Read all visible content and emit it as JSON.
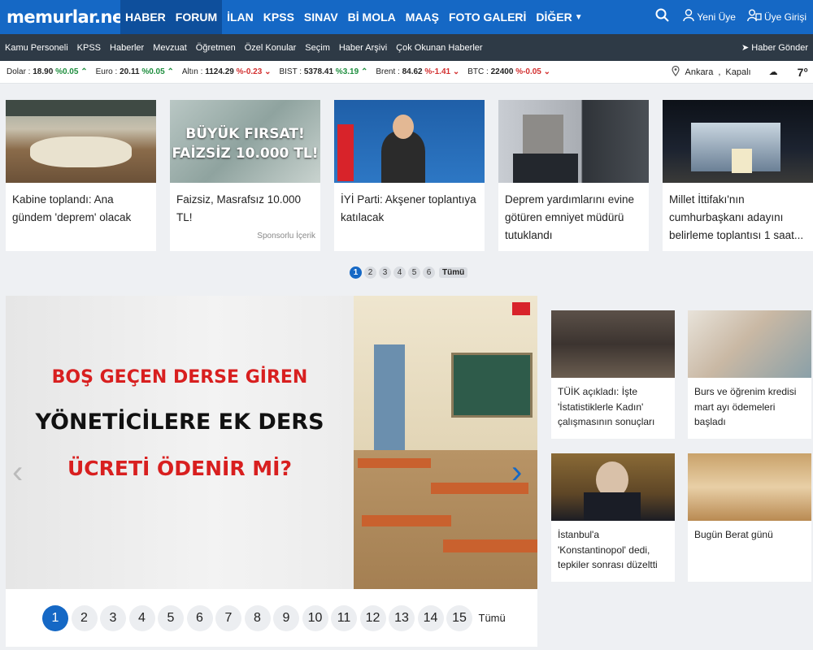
{
  "logo": "memurlar.net",
  "nav": [
    {
      "label": "HABER",
      "active": true
    },
    {
      "label": "FORUM",
      "active": true
    },
    {
      "label": "İLAN"
    },
    {
      "label": "KPSS"
    },
    {
      "label": "SINAV"
    },
    {
      "label": "Bİ MOLA"
    },
    {
      "label": "MAAŞ"
    },
    {
      "label": "FOTO GALERİ"
    },
    {
      "label": "DİĞER"
    }
  ],
  "top_right": {
    "new_member": "Yeni Üye",
    "login": "Üye Girişi"
  },
  "subnav": [
    "Kamu Personeli",
    "KPSS",
    "Haberler",
    "Mevzuat",
    "Öğretmen",
    "Özel Konular",
    "Seçim",
    "Haber Arşivi",
    "Çok Okunan Haberler"
  ],
  "send_news": "Haber Gönder",
  "ticker": [
    {
      "name": "Dolar",
      "value": "18.90",
      "change": "%0.05",
      "dir": "up"
    },
    {
      "name": "Euro",
      "value": "20.11",
      "change": "%0.05",
      "dir": "up"
    },
    {
      "name": "Altın",
      "value": "1124.29",
      "change": "%-0.23",
      "dir": "down"
    },
    {
      "name": "BIST",
      "value": "5378.41",
      "change": "%3.19",
      "dir": "up"
    },
    {
      "name": "Brent",
      "value": "84.62",
      "change": "%-1.41",
      "dir": "down"
    },
    {
      "name": "BTC",
      "value": "22400",
      "change": "%-0.05",
      "dir": "down"
    }
  ],
  "weather": {
    "city": "Ankara",
    "condition": "Kapalı",
    "temp": "7°"
  },
  "cards": [
    {
      "title": "Kabine toplandı: Ana gündem 'deprem' olacak"
    },
    {
      "title": "Faizsiz, Masrafsız 10.000 TL!",
      "sponsored": "Sponsorlu İçerik",
      "img_line1": "BÜYÜK FIRSAT!",
      "img_line2": "FAİZSİZ 10.000 TL!"
    },
    {
      "title": "İYİ Parti: Akşener toplantıya katılacak"
    },
    {
      "title": "Deprem yardımlarını evine götüren emniyet müdürü tutuklandı"
    },
    {
      "title": "Millet İttifakı'nın cumhurbaşkanı adayını belirleme toplantısı 1 saat..."
    }
  ],
  "pager_small": {
    "pages": [
      "1",
      "2",
      "3",
      "4",
      "5",
      "6"
    ],
    "all": "Tümü"
  },
  "hero": {
    "line1": "BOŞ GEÇEN DERSE GİREN",
    "line2": "YÖNETİCİLERE EK DERS",
    "line3": "ÜCRETİ ÖDENİR Mİ?"
  },
  "pager_large": {
    "pages": [
      "1",
      "2",
      "3",
      "4",
      "5",
      "6",
      "7",
      "8",
      "9",
      "10",
      "11",
      "12",
      "13",
      "14",
      "15"
    ],
    "all": "Tümü"
  },
  "side_news": [
    {
      "title": "TÜİK açıkladı: İşte 'İstatistiklerle Kadın' çalışmasının sonuçları"
    },
    {
      "title": "Burs ve öğrenim kredisi mart ayı ödemeleri başladı"
    },
    {
      "title": "İstanbul'a 'Konstantinopol' dedi, tepkiler sonrası düzeltti"
    },
    {
      "title": "Bugün Berat günü"
    }
  ]
}
